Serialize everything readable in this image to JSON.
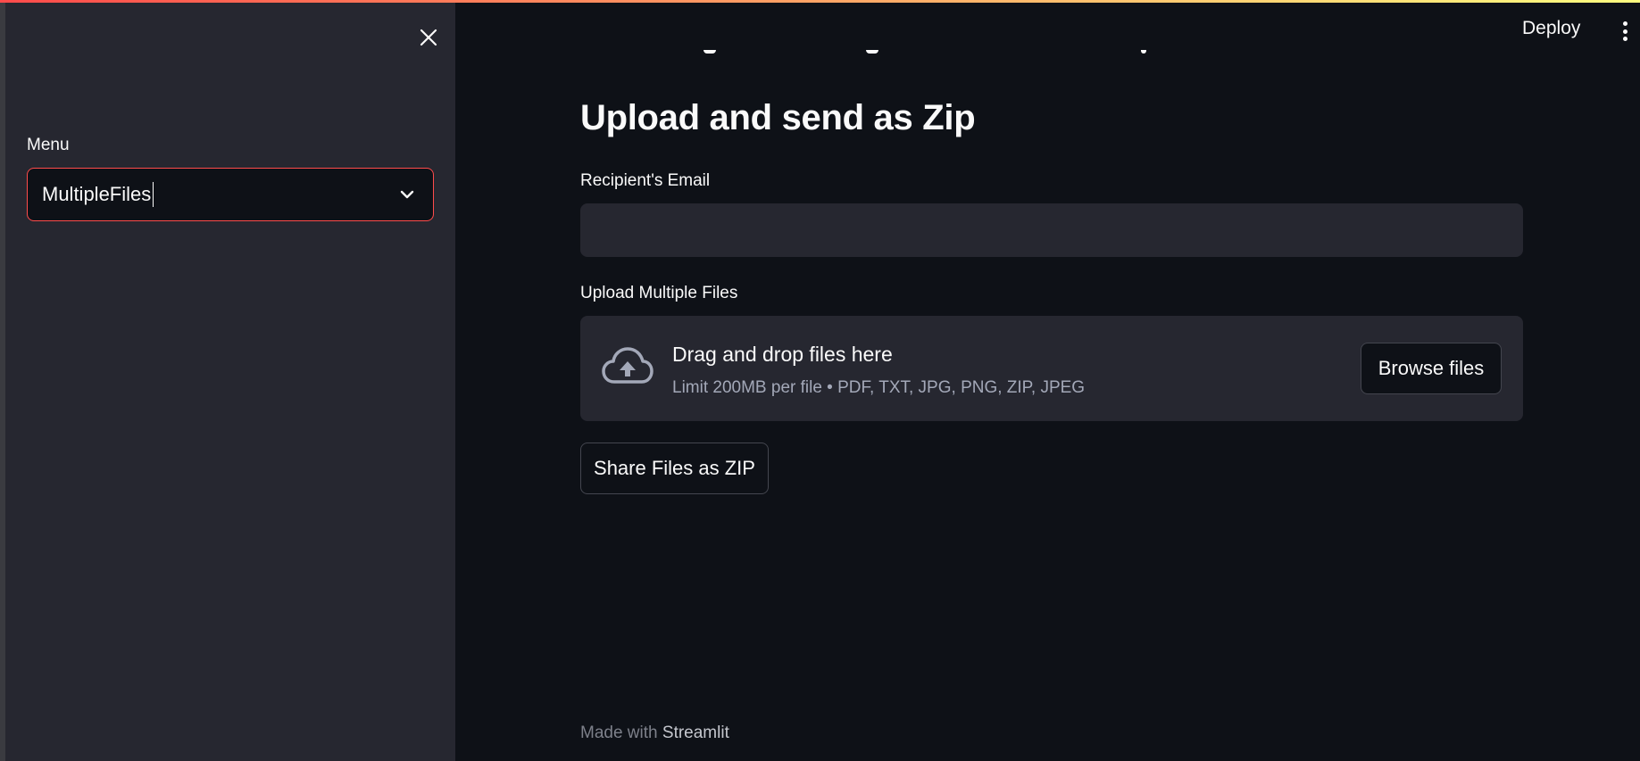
{
  "sidebar": {
    "close_icon": "close-icon",
    "menu_label": "Menu",
    "menu_value": "MultipleFiles",
    "chevron_icon": "chevron-down-icon"
  },
  "header": {
    "deploy_label": "Deploy",
    "more_icon": "more-vertical-icon"
  },
  "main": {
    "title": "Upload and send as Zip",
    "email_label": "Recipient's Email",
    "email_value": "",
    "upload_label": "Upload Multiple Files",
    "dropzone": {
      "icon": "cloud-upload-icon",
      "title": "Drag and drop files here",
      "subtitle": "Limit 200MB per file • PDF, TXT, JPG, PNG, ZIP, JPEG",
      "browse_label": "Browse files"
    },
    "share_label": "Share Files as ZIP"
  },
  "footer": {
    "made_with": "Made with",
    "brand": "Streamlit"
  },
  "colors": {
    "background": "#0e1117",
    "sidebar": "#262730",
    "accent": "#ff4b4b",
    "input_bg": "#262730",
    "muted_text": "#a3a8b8"
  }
}
